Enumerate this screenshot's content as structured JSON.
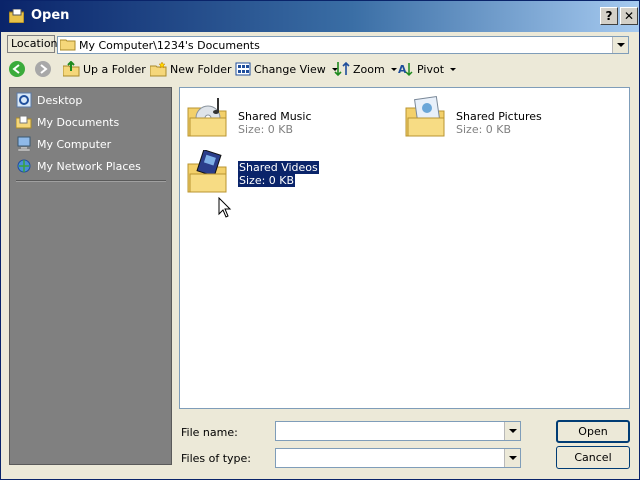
{
  "window": {
    "title": "Open",
    "help_label": "?",
    "close_label": "✕"
  },
  "location": {
    "label": "Location",
    "path": "My Computer\\1234's Documents"
  },
  "toolbar": {
    "up_folder": "Up a Folder",
    "new_folder": "New Folder",
    "change_view": "Change View",
    "zoom": "Zoom",
    "pivot": "Pivot"
  },
  "sidebar": {
    "items": [
      {
        "label": "Desktop",
        "icon": "desktop-icon"
      },
      {
        "label": "My Documents",
        "icon": "my-documents-icon"
      },
      {
        "label": "My Computer",
        "icon": "my-computer-icon"
      },
      {
        "label": "My Network Places",
        "icon": "network-places-icon"
      }
    ]
  },
  "files": [
    {
      "name": "Shared Music",
      "size": "Size: 0 KB",
      "icon": "music-folder-icon",
      "selected": false
    },
    {
      "name": "Shared Pictures",
      "size": "Size: 0 KB",
      "icon": "pictures-folder-icon",
      "selected": false
    },
    {
      "name": "Shared Videos",
      "size": "Size: 0 KB",
      "icon": "videos-folder-icon",
      "selected": true
    }
  ],
  "form": {
    "file_name_label": "File name:",
    "file_name_value": "",
    "file_type_label": "Files of type:",
    "file_type_value": "",
    "open_button": "Open",
    "cancel_button": "Cancel"
  },
  "colors": {
    "title_bar": "#0a246a",
    "selection": "#0a246a",
    "sidebar_bg": "#808080",
    "dialog_bg": "#ece9d8"
  }
}
